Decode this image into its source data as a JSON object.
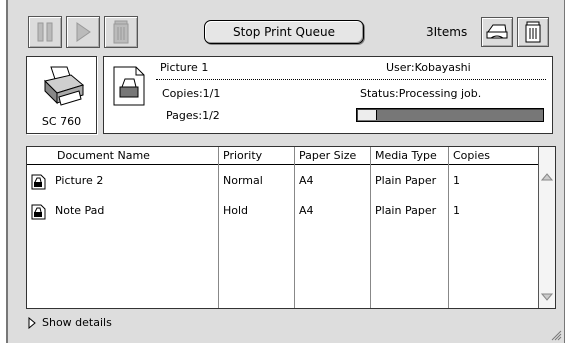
{
  "toolbar": {
    "pause_icon": "pause-icon",
    "resume_icon": "play-icon",
    "delete_icon": "trash-icon",
    "stop_label": "Stop Print Queue",
    "item_count": "3Items",
    "right_icons": [
      "printer-icon",
      "trash-icon"
    ]
  },
  "printer": {
    "model": "SC 760",
    "icon": "printer-icon"
  },
  "job": {
    "name": "Picture 1",
    "user": "User:Kobayashi",
    "copies": "Copies:1/1",
    "pages": "Pages:1/2",
    "status": "Status:Processing job.",
    "progress": 0.1,
    "icon": "document-icon"
  },
  "table": {
    "columns": [
      "Document Name",
      "Priority",
      "Paper Size",
      "Media Type",
      "Copies"
    ],
    "rows": [
      {
        "name": "Picture 2",
        "priority": "Normal",
        "paper_size": "A4",
        "media_type": "Plain Paper",
        "copies": "1"
      },
      {
        "name": "Note Pad",
        "priority": "Hold",
        "paper_size": "A4",
        "media_type": "Plain Paper",
        "copies": "1"
      }
    ]
  },
  "footer": {
    "details_label": "Show details"
  }
}
